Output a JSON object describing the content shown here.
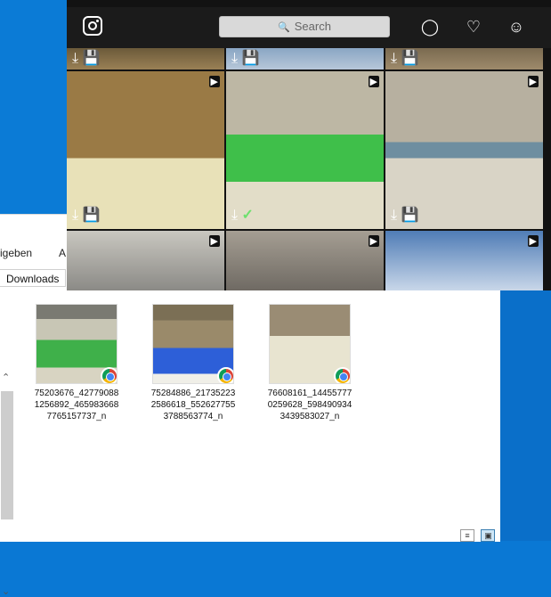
{
  "explorer": {
    "ribbon_tab_1": "igeben",
    "ribbon_tab_2": "A",
    "address": "Downloads",
    "files": [
      {
        "name": "75203676_427790881256892_4659836687765157737_n"
      },
      {
        "name": "75284886_217352232586618_5526277553788563774_n"
      },
      {
        "name": "76608161_144557770259628_5984909343439583027_n"
      }
    ],
    "view_icons": [
      "details-view-icon",
      "large-icons-view-icon"
    ]
  },
  "instagram": {
    "search_placeholder": "Search",
    "icons": [
      "instagram-logo-icon",
      "compass-icon",
      "heart-icon",
      "user-icon"
    ],
    "cell_icons": [
      "download-icon",
      "save-icon",
      "video-icon",
      "checkmark-icon"
    ]
  },
  "colors": {
    "desktop_blue": "#0a78d4",
    "instagram_bg": "#121212",
    "check_green": "#6ee16e"
  }
}
